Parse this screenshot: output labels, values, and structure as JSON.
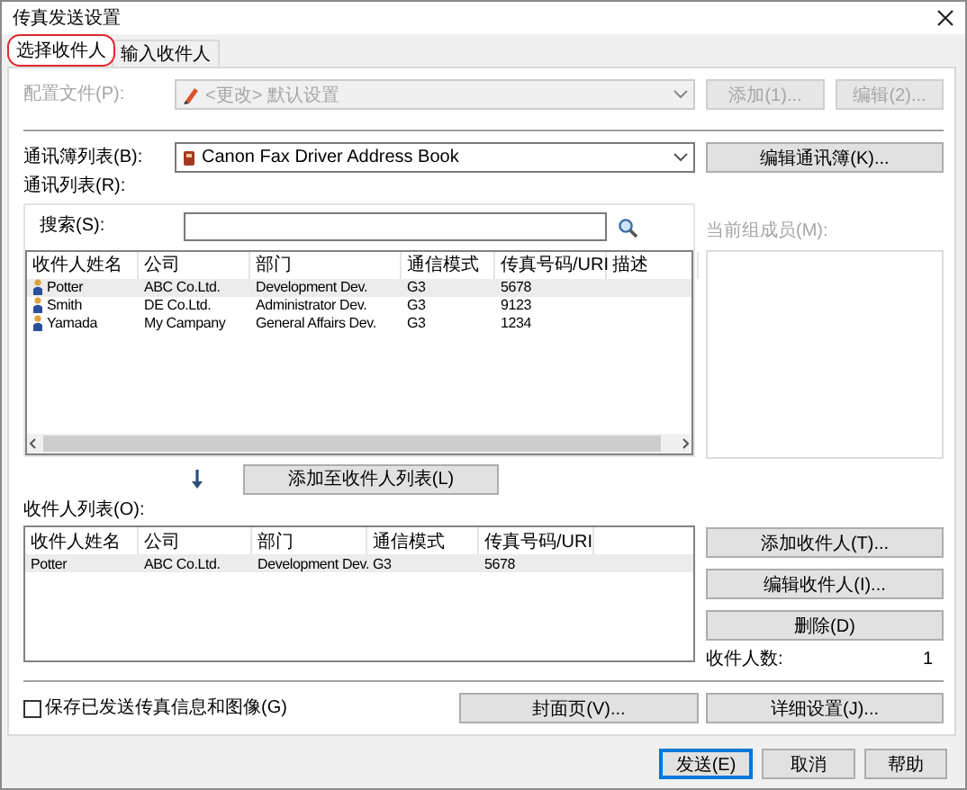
{
  "window": {
    "title": "传真发送设置"
  },
  "tabs": [
    {
      "label": "选择收件人",
      "selected": true,
      "highlighted": true
    },
    {
      "label": "输入收件人",
      "selected": false,
      "highlighted": false
    }
  ],
  "profile": {
    "label": "配置文件(P):",
    "value": "<更改> 默认设置",
    "disabled": true,
    "buttons": [
      {
        "label": "添加(1)...",
        "disabled": true
      },
      {
        "label": "编辑(2)...",
        "disabled": true
      }
    ]
  },
  "address_book": {
    "label": "通讯簿列表(B):",
    "value": "Canon Fax Driver Address Book",
    "button": "编辑通讯簿(K)..."
  },
  "address_list": {
    "label": "通讯列表(R):",
    "search_label": "搜索(S):",
    "columns": [
      "收件人姓名",
      "公司",
      "部门",
      "通信模式",
      "传真号码/URI",
      "描述"
    ],
    "rows": [
      {
        "cells": [
          "Potter",
          "ABC Co.Ltd.",
          "Development Dev.",
          "G3",
          "5678"
        ],
        "selected": true
      },
      {
        "cells": [
          "Smith",
          "DE Co.Ltd.",
          "Administrator Dev.",
          "G3",
          "9123"
        ],
        "selected": false
      },
      {
        "cells": [
          "Yamada",
          "My Campany",
          "General Affairs Dev.",
          "G3",
          "1234"
        ],
        "selected": false
      }
    ]
  },
  "group_members": {
    "label": "当前组成员(M):",
    "disabled": true
  },
  "add_button": "添加至收件人列表(L)",
  "recipient_list": {
    "label": "收件人列表(O):",
    "columns": [
      "收件人姓名",
      "公司",
      "部门",
      "通信模式",
      "传真号码/URI"
    ],
    "rows": [
      {
        "cells": [
          "Potter",
          "ABC Co.Ltd.",
          "Development Dev.",
          "G3",
          "5678"
        ],
        "selected": true
      }
    ]
  },
  "recipient_buttons": [
    "添加收件人(T)...",
    "编辑收件人(I)...",
    "删除(D)"
  ],
  "recipient_count": {
    "label": "收件人数:",
    "value": "1"
  },
  "save_option": {
    "label": "保存已发送传真信息和图像(G)",
    "checked": false
  },
  "option_buttons": [
    "封面页(V)...",
    "详细设置(J)..."
  ],
  "dialog_buttons": [
    {
      "label": "发送(E)",
      "default": true
    },
    {
      "label": "取消",
      "default": false
    },
    {
      "label": "帮助",
      "default": false
    }
  ]
}
